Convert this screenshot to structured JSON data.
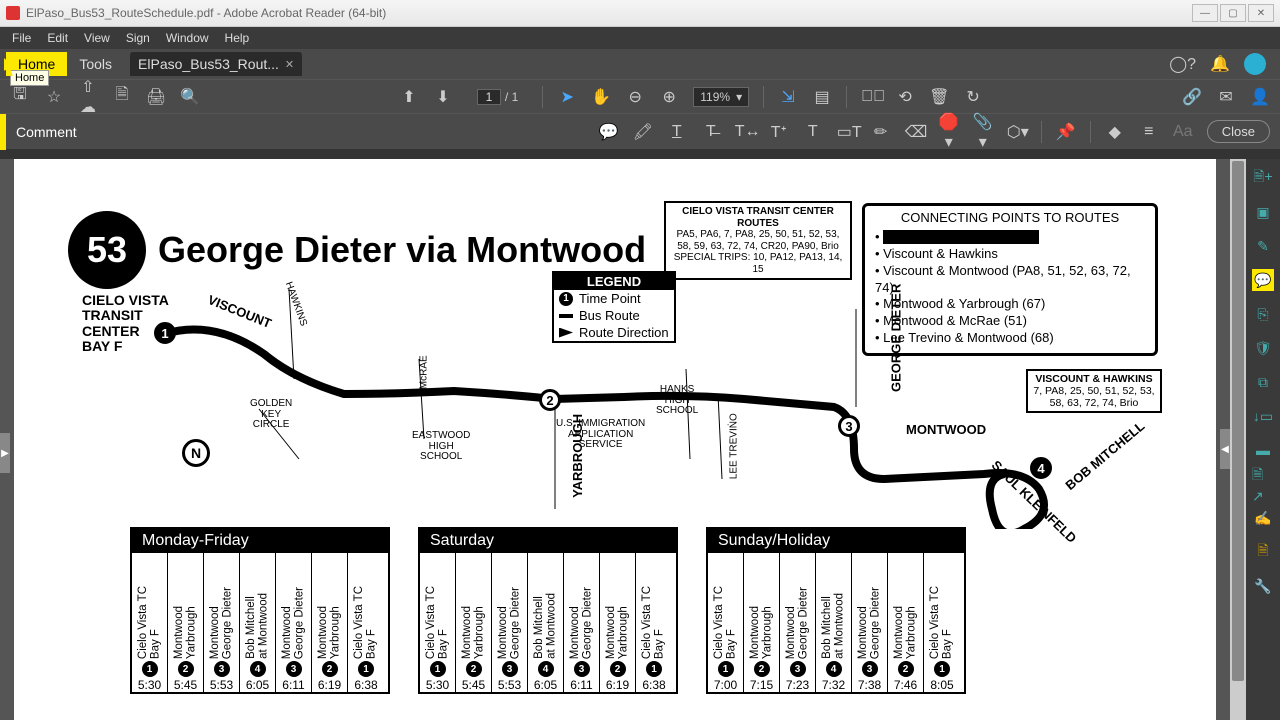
{
  "titlebar": {
    "filename": "ElPaso_Bus53_RouteSchedule.pdf - Adobe Acrobat Reader (64-bit)"
  },
  "menubar": [
    "File",
    "Edit",
    "View",
    "Sign",
    "Window",
    "Help"
  ],
  "tabs": {
    "home": "Home",
    "tools": "Tools",
    "file": "ElPaso_Bus53_Rout...",
    "tooltip": "Home"
  },
  "toolbar": {
    "page_current": "1",
    "page_total": "/  1",
    "zoom": "119%"
  },
  "comment": {
    "label": "Comment",
    "close": "Close"
  },
  "route": {
    "number": "53",
    "title": "George Dieter via Montwood",
    "origin": "CIELO VISTA\nTRANSIT\nCENTER\nBAY F"
  },
  "legend": {
    "title": "LEGEND",
    "items": [
      "Time Point",
      "Bus Route",
      "Route Direction"
    ]
  },
  "cvtc": {
    "line1": "CIELO VISTA TRANSIT CENTER ROUTES",
    "line2": "PA5, PA6, 7, PA8, 25, 50, 51, 52, 53, 58, 59, 63, 72, 74, CR20, PA90, Brio",
    "line3": "SPECIAL TRIPS: 10, PA12, PA13, 14, 15"
  },
  "conn": {
    "title": "CONNECTING POINTS TO ROUTES",
    "items": [
      "Viscount & Hawkins",
      "Viscount & Montwood (PA8, 51, 52, 63, 72, 74)",
      "Montwood & Yarbrough (67)",
      "Montwood & McRae (51)",
      "Lee Trevino & Montwood (68)"
    ]
  },
  "vhbox": {
    "l1": "VISCOUNT & HAWKINS",
    "l2": "7, PA8, 25, 50, 51, 52, 53, 58, 63, 72, 74, Brio"
  },
  "map_labels": {
    "viscount": "VISCOUNT",
    "hawkins": "HAWKINS",
    "golden": "GOLDEN\nKEY\nCIRCLE",
    "mcrae": "McRAE",
    "eastwood": "EASTWOOD\nHIGH\nSCHOOL",
    "yarbrough": "YARBROUGH",
    "usimmig": "U.S. IMMIGRATION\nAPPLICATION\nSERVICE",
    "hanks": "HANKS\nHIGH\nSCHOOL",
    "leetrev": "LEE TREVIṄO",
    "gdieter": "GEORGE DIETER",
    "montwood": "MONTWOOD",
    "bobm": "BOB MITCHELL",
    "saulk": "SAUL KLEINFELD",
    "compass": "N"
  },
  "schedules": [
    {
      "title": "Monday-Friday",
      "cols": [
        {
          "h": "Cielo Vista TC\nBay F",
          "tp": "1",
          "t": "5:30"
        },
        {
          "h": "Montwood\nYarbrough",
          "tp": "2",
          "t": "5:45"
        },
        {
          "h": "Montwood\nGeorge Dieter",
          "tp": "3",
          "t": "5:53"
        },
        {
          "h": "Bob Mitchell\nat Montwood",
          "tp": "4",
          "t": "6:05"
        },
        {
          "h": "Montwood\nGeorge Dieter",
          "tp": "3",
          "t": "6:11"
        },
        {
          "h": "Montwood\nYarbrough",
          "tp": "2",
          "t": "6:19"
        },
        {
          "h": "Cielo Vista TC\nBay F",
          "tp": "1",
          "t": "6:38"
        }
      ]
    },
    {
      "title": "Saturday",
      "cols": [
        {
          "h": "Cielo Vista TC\nBay F",
          "tp": "1",
          "t": "5:30"
        },
        {
          "h": "Montwood\nYarbrough",
          "tp": "2",
          "t": "5:45"
        },
        {
          "h": "Montwood\nGeorge Dieter",
          "tp": "3",
          "t": "5:53"
        },
        {
          "h": "Bob Mitchell\nat Montwood",
          "tp": "4",
          "t": "6:05"
        },
        {
          "h": "Montwood\nGeorge Dieter",
          "tp": "3",
          "t": "6:11"
        },
        {
          "h": "Montwood\nYarbrough",
          "tp": "2",
          "t": "6:19"
        },
        {
          "h": "Cielo Vista TC\nBay F",
          "tp": "1",
          "t": "6:38"
        }
      ]
    },
    {
      "title": "Sunday/Holiday",
      "cols": [
        {
          "h": "Cielo Vista TC\nBay F",
          "tp": "1",
          "t": "7:00"
        },
        {
          "h": "Montwood\nYarbrough",
          "tp": "2",
          "t": "7:15"
        },
        {
          "h": "Montwood\nGeorge Dieter",
          "tp": "3",
          "t": "7:23"
        },
        {
          "h": "Bob Mitchell\nat Montwood",
          "tp": "4",
          "t": "7:32"
        },
        {
          "h": "Montwood\nGeorge Dieter",
          "tp": "3",
          "t": "7:38"
        },
        {
          "h": "Montwood\nYarbrough",
          "tp": "2",
          "t": "7:46"
        },
        {
          "h": "Cielo Vista TC\nBay F",
          "tp": "1",
          "t": "8:05"
        }
      ]
    }
  ]
}
